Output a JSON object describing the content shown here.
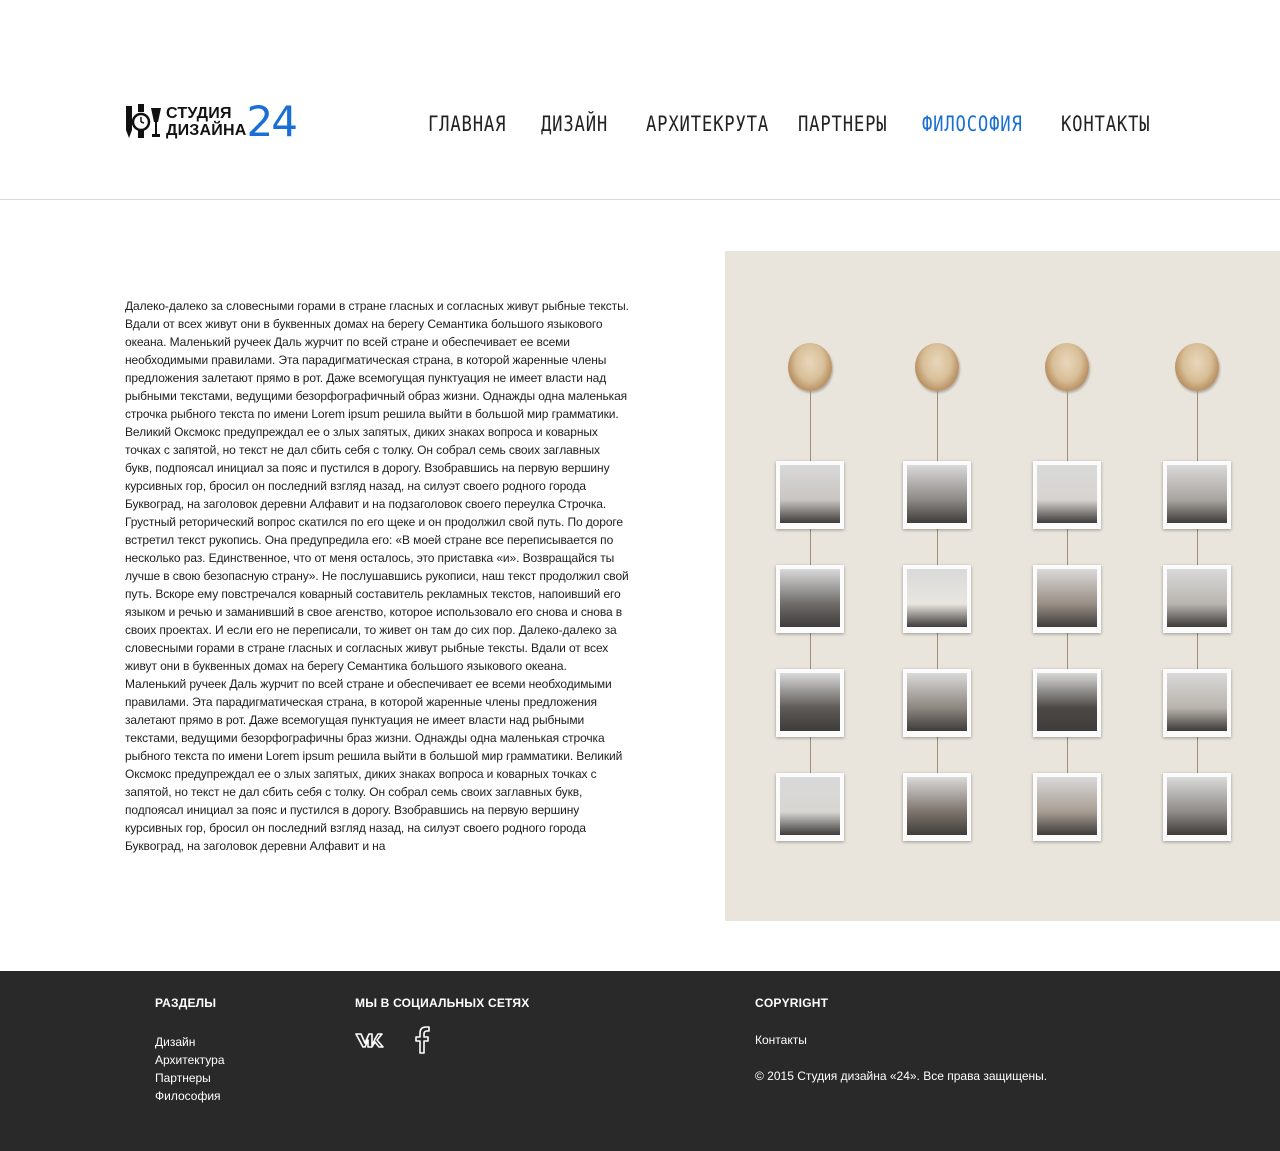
{
  "header": {
    "logo": {
      "line1": "СТУДИЯ",
      "line2": "ДИЗАЙНА",
      "number": "24"
    },
    "nav": [
      {
        "label": "Главная",
        "active": false
      },
      {
        "label": "Дизайн",
        "active": false
      },
      {
        "label": "Архитекрута",
        "active": false
      },
      {
        "label": "Партнеры",
        "active": false
      },
      {
        "label": "Философия",
        "active": true
      },
      {
        "label": "Контакты",
        "active": false
      }
    ]
  },
  "main": {
    "text": "Далеко-далеко за словесными горами в стране гласных и согласных живут рыбные тексты. Вдали от всех живут они в буквенных домах на берегу Семантика большого языкового океана. Маленький ручеек Даль журчит по всей стране и обеспечивает ее всеми необходимыми правилами. Эта парадигматическая страна, в которой жаренные члены предложения залетают прямо в рот. Даже всемогущая пунктуация не имеет власти над рыбными текстами, ведущими безорфографичный образ жизни. Однажды одна маленькая строчка рыбного текста по имени Lorem ipsum решила выйти в большой мир грамматики. Великий Оксмокс предупреждал ее о злых запятых, диких знаках вопроса и коварных точках с запятой, но текст не дал сбить себя с толку. Он собрал семь своих заглавных букв, подпоясал инициал за пояс и пустился в дорогу. Взобравшись на первую вершину курсивных гор, бросил он последний взгляд назад, на силуэт своего родного города Буквоград, на заголовок деревни Алфавит и на подзаголовок своего переулка Строчка. Грустный реторический вопрос скатился по его щеке и он продолжил свой путь. По дороге встретил текст рукопись. Она предупредила его: «В моей стране все переписывается по несколько раз. Единственное, что от меня осталось, это приставка «и». Возвращайся ты лучше в свою безопасную страну». Не послушавшись рукописи, наш текст продолжил свой путь. Вскоре ему повстречался коварный составитель рекламных текстов, напоивший его языком и речью и заманивший в свое агенство, которое использовало его снова и снова в своих проектах. И если его не переписали, то живет он там до сих пор. Далеко-далеко за словесными горами в стране гласных и согласных живут рыбные тексты. Вдали от всех живут они в буквенных домах на берегу Семантика большого языкового океана. Маленький ручеек Даль журчит по всей стране и обеспечивает ее всеми необходимыми правилами. Эта парадигматическая страна, в которой жаренные члены предложения залетают прямо в рот. Даже всемогущая пунктуация не имеет власти над рыбными текстами, ведущими безорфографичны браз жизни. Однажды одна маленькая строчка рыбного текста по имени Lorem ipsum решила выйти в большой мир грамматики. Великий Оксмокс предупреждал ее о злых запятых, диких знаках вопроса и коварных точках с запятой, но текст не дал сбить себя с толку. Он собрал семь своих заглавных букв, подпоясал инициал за пояс и пустился в дорогу. Взобравшись на первую вершину курсивных гор, бросил он последний взгляд назад, на силуэт своего родного города Буквоград, на заголовок деревни Алфавит и на"
  },
  "footer": {
    "sections_title": "РАЗДЕЛЫ",
    "sections": [
      "Дизайн",
      "Архитектура",
      "Партнеры",
      "Философия"
    ],
    "social_title": "МЫ В СОЦИАЛЬНЫХ СЕТЯХ",
    "social": [
      {
        "icon": "vk-icon"
      },
      {
        "icon": "facebook-icon"
      }
    ],
    "copyright_title": "COPYRIGHT",
    "contacts_link": "Контакты",
    "copyright_text": "© 2015 Студия дизайна «24». Все права защищены."
  },
  "colors": {
    "accent": "#1a6fd4",
    "footer_bg": "#292929",
    "photo_wall": "#e9e5dc"
  }
}
